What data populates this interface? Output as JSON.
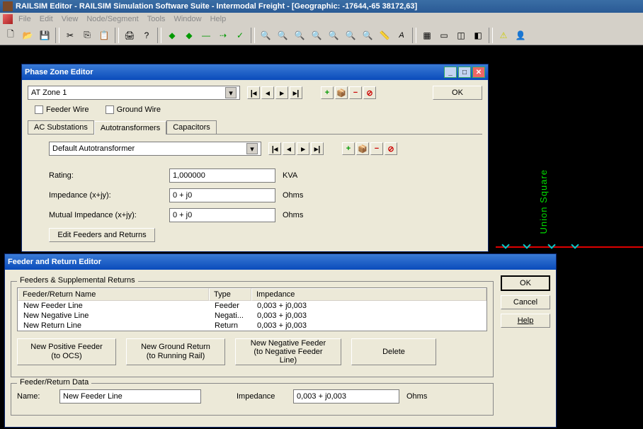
{
  "title": "RAILSIM Editor - RAILSIM Simulation Software Suite - Intermodal Freight - [Geographic: -17644,-65 38172,63]",
  "menu": {
    "file": "File",
    "edit": "Edit",
    "view": "View",
    "node": "Node/Segment",
    "tools": "Tools",
    "window": "Window",
    "help": "Help"
  },
  "station": "Union Square",
  "phase_dialog": {
    "title": "Phase Zone Editor",
    "zone": "AT Zone 1",
    "ok": "OK",
    "feeder_wire": "Feeder Wire",
    "ground_wire": "Ground Wire",
    "tabs": {
      "ac": "AC Substations",
      "auto": "Autotransformers",
      "cap": "Capacitors"
    },
    "autotrans": "Default Autotransformer",
    "rating_label": "Rating:",
    "rating_value": "1,000000",
    "rating_unit": "KVA",
    "imp_label": "Impedance (x+jy):",
    "imp_value": "0 + j0",
    "imp_unit": "Ohms",
    "mimp_label": "Mutual Impedance (x+jy):",
    "mimp_value": "0 + j0",
    "mimp_unit": "Ohms",
    "edit_feeders": "Edit Feeders and Returns"
  },
  "feeder_dialog": {
    "title": "Feeder and Return Editor",
    "groupbox": "Feeders & Supplemental Returns",
    "ok": "OK",
    "cancel": "Cancel",
    "help": "Help",
    "headers": {
      "name": "Feeder/Return Name",
      "type": "Type",
      "imp": "Impedance"
    },
    "rows": [
      {
        "name": "New Feeder Line",
        "type": "Feeder",
        "imp": "0,003 + j0,003"
      },
      {
        "name": "New Negative Line",
        "type": "Negati...",
        "imp": "0,003 + j0,003"
      },
      {
        "name": "New Return Line",
        "type": "Return",
        "imp": "0,003 + j0,003"
      }
    ],
    "btns": {
      "pos": "New Positive Feeder\n(to OCS)",
      "grd": "New Ground Return\n(to Running Rail)",
      "neg": "New Negative Feeder\n(to Negative Feeder\nLine)",
      "del": "Delete"
    },
    "data_group": "Feeder/Return Data",
    "name_label": "Name:",
    "name_value": "New Feeder Line",
    "imp_label": "Impedance",
    "imp_value": "0,003 + j0,003",
    "imp_unit": "Ohms"
  }
}
